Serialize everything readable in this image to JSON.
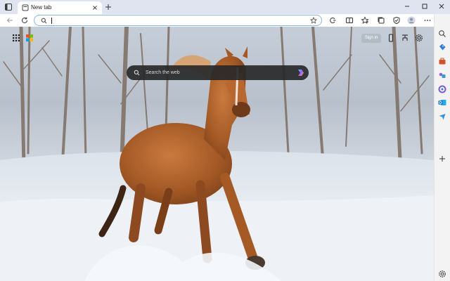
{
  "tab": {
    "title": "New tab"
  },
  "address_bar": {
    "value": "",
    "placeholder": ""
  },
  "search": {
    "placeholder": "Search the web"
  },
  "header": {
    "sign_in_label": "Sign in"
  },
  "colors": {
    "accent": "#0f6cbd",
    "tabstrip": "#dfe4f0",
    "search_box": "#2b2b2b"
  },
  "icons": {
    "toolbar": [
      "back-icon",
      "refresh-icon",
      "favorite-star-icon",
      "extensions-icon",
      "split-screen-icon",
      "favorites-icon",
      "collections-icon",
      "browser-essentials-icon",
      "profile-avatar",
      "more-icon",
      "copilot-icon"
    ],
    "sidebar": [
      "search-icon",
      "shopping-icon",
      "tools-icon",
      "games-icon",
      "microsoft-365-icon",
      "outlook-icon",
      "drop-icon",
      "add-icon",
      "settings-icon"
    ]
  }
}
